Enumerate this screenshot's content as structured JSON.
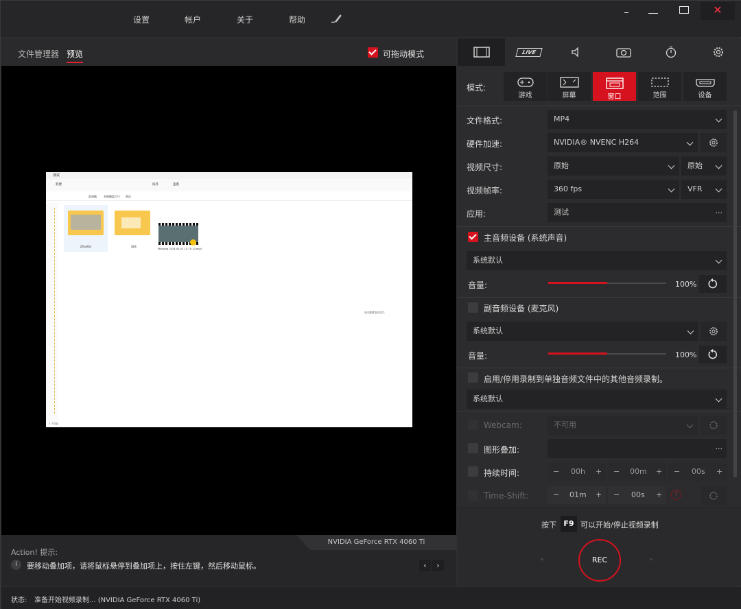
{
  "menu": [
    "设置",
    "帐户",
    "关于",
    "帮助"
  ],
  "window_controls": {
    "minimize": "–",
    "restore": "□",
    "close": "✕"
  },
  "left": {
    "tabs": [
      "文件管理器",
      "预览"
    ],
    "active_tab": "预览",
    "drag_mode": {
      "label": "可拖动模式",
      "checked": true
    },
    "preview_screenshot": {
      "title": "测试",
      "toolbar": [
        "新建",
        "排序",
        "查看"
      ],
      "path": [
        "此电脑",
        "本地磁盘 (F:)",
        "测试"
      ],
      "items": [
        "Zhanlibi",
        "测试",
        "Mingjing 2024-05-01 15-19-10.mp4"
      ],
      "side_text": "选中要预览的文件。",
      "status": "3 个项目"
    },
    "gpu_label": "NVIDIA GeForce RTX 4060 Ti",
    "hint_title": "Action! 提示:",
    "hint_text": "要移动叠加项，请将鼠标悬停到叠加项上，按住左键，然后移动鼠标。"
  },
  "right": {
    "top_tabs": [
      "film-icon",
      "live-icon",
      "speaker-icon",
      "camera-icon",
      "timer-icon",
      "gear-icon"
    ],
    "live_label": "LIVE",
    "mode_label": "模式:",
    "modes": [
      {
        "label": "游戏",
        "icon": "gamepad-icon"
      },
      {
        "label": "屏幕",
        "icon": "screen-icon"
      },
      {
        "label": "窗口",
        "icon": "window-icon",
        "active": true
      },
      {
        "label": "范围",
        "icon": "region-icon"
      },
      {
        "label": "设备",
        "icon": "device-icon"
      }
    ],
    "file_format": {
      "label": "文件格式:",
      "value": "MP4"
    },
    "hw_accel": {
      "label": "硬件加速:",
      "value": "NVIDIA® NVENC H264"
    },
    "video_size": {
      "label": "视频尺寸:",
      "value": "原始",
      "value2": "原始"
    },
    "frame_rate": {
      "label": "视频帧率:",
      "value": "360 fps",
      "value2": "VFR"
    },
    "app": {
      "label": "应用:",
      "value": "测试",
      "dots": "..."
    },
    "main_audio": {
      "label": "主音频设备 (系统声音)",
      "checked": true,
      "device": "系统默认",
      "volume_label": "音量:",
      "volume": "100%",
      "volume_fraction": 0.5
    },
    "sub_audio": {
      "label": "副音频设备 (麦克风)",
      "checked": false,
      "device": "系统默认",
      "volume_label": "音量:",
      "volume": "100%",
      "volume_fraction": 0.5
    },
    "extra_audio": {
      "label": "启用/停用录制到单独音频文件中的其他音频录制。",
      "checked": false,
      "device": "系统默认"
    },
    "webcam": {
      "label": "Webcam:",
      "value": "不可用"
    },
    "overlay": {
      "label": "图形叠加:",
      "dots": "..."
    },
    "duration": {
      "label": "持续时间:",
      "h": "00h",
      "m": "00m",
      "s": "00s"
    },
    "timeshift": {
      "label": "Time-Shift:",
      "m": "01m",
      "s": "00s",
      "info": "?"
    },
    "hotkey": {
      "prefix": "按下",
      "key": "F9",
      "suffix": "可以开始/停止视频录制"
    },
    "rec_label": "REC"
  },
  "status": {
    "label": "状态:",
    "text": "准备开始视频录制... (NVIDIA GeForce RTX 4060 Ti)"
  },
  "colors": {
    "accent": "#d7121f",
    "bg": "#2e2e30"
  }
}
